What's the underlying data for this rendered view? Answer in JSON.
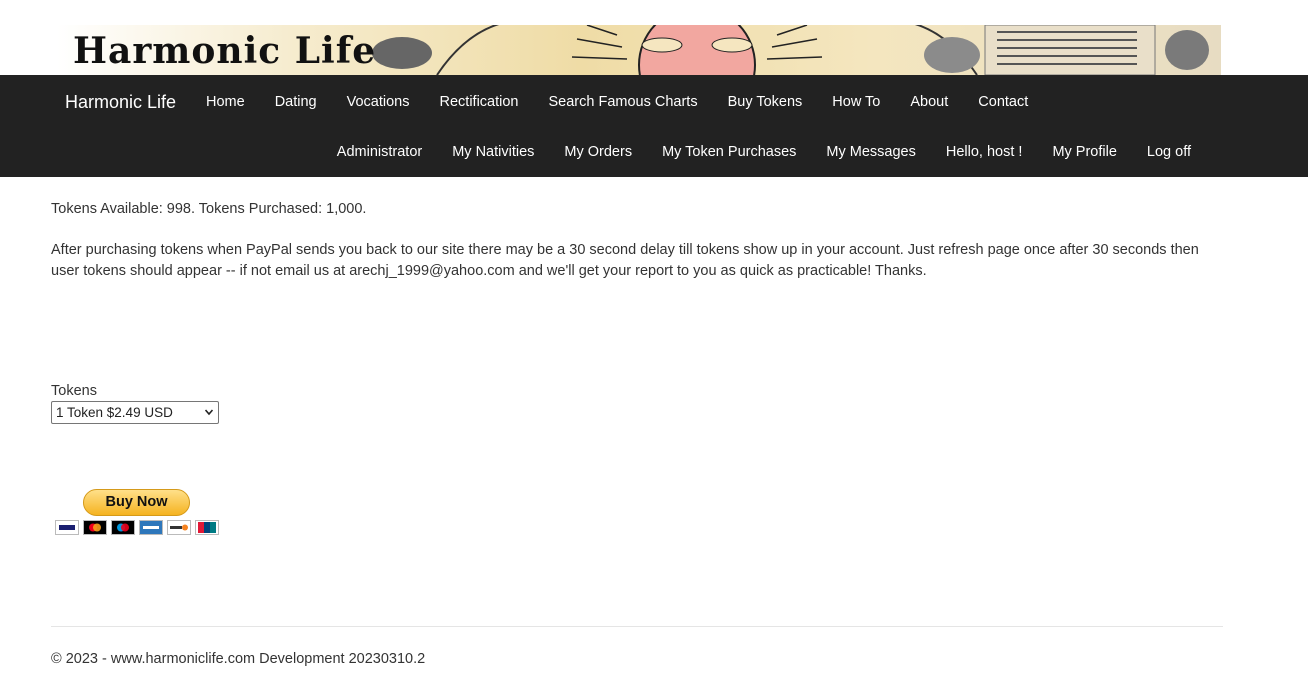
{
  "banner": {
    "logo_text": "Harmonic Life"
  },
  "navbar": {
    "brand": "Harmonic Life",
    "main_links": [
      "Home",
      "Dating",
      "Vocations",
      "Rectification",
      "Search Famous Charts",
      "Buy Tokens",
      "How To",
      "About",
      "Contact"
    ],
    "user_links": [
      "Administrator",
      "My Nativities",
      "My Orders",
      "My Token Purchases",
      "My Messages",
      "Hello, host !",
      "My Profile",
      "Log off"
    ]
  },
  "content": {
    "tokens_status": "Tokens Available: 998. Tokens Purchased: 1,000.",
    "notice": "After purchasing tokens when PayPal sends you back to our site there may be a 30 second delay till tokens show up in your account. Just refresh page once after 30 seconds then user tokens should appear -- if not email us at arechj_1999@yahoo.com and we'll get your report to you as quick as practicable! Thanks.",
    "tokens_label": "Tokens",
    "tokens_selected": "1 Token $2.49 USD",
    "buy_now_label": "Buy Now",
    "payment_cards": [
      "visa-icon",
      "mastercard-icon",
      "maestro-icon",
      "amex-icon",
      "discover-icon",
      "unionpay-icon"
    ]
  },
  "footer": {
    "text": "© 2023 - www.harmoniclife.com Development 20230310.2"
  },
  "colors": {
    "navbar_bg": "#222222",
    "nav_text": "#ffffff",
    "body_text": "#333333",
    "paypal_gold": "#f5b321"
  }
}
